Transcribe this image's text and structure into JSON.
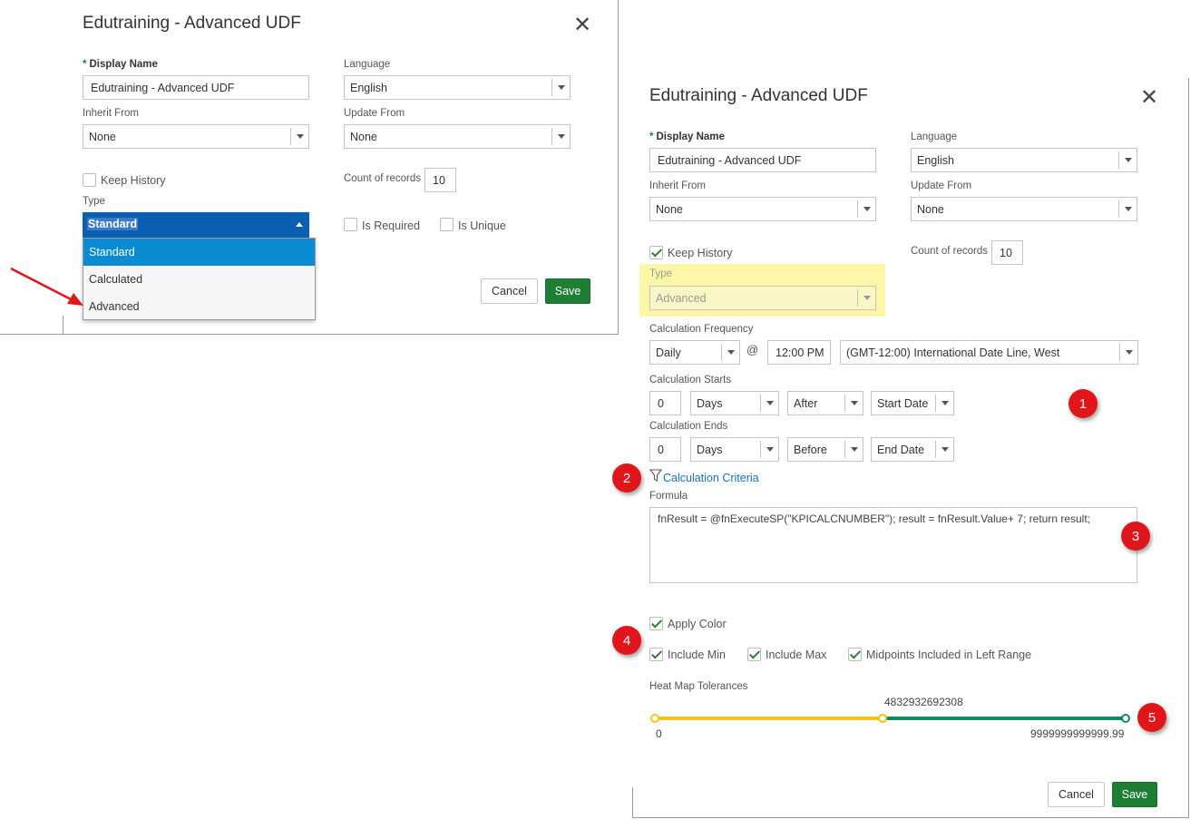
{
  "dialog1": {
    "title": "Edutraining - Advanced UDF",
    "display_name_label": "Display Name",
    "display_name_value": "Edutraining - Advanced UDF",
    "language_label": "Language",
    "language_value": "English",
    "inherit_from_label": "Inherit From",
    "inherit_from_value": "None",
    "update_from_label": "Update From",
    "update_from_value": "None",
    "keep_history_label": "Keep History",
    "count_of_records_label": "Count of records",
    "count_of_records_value": "10",
    "type_label": "Type",
    "type_value": "Standard",
    "type_options": [
      "Standard",
      "Calculated",
      "Advanced"
    ],
    "is_required_label": "Is Required",
    "is_unique_label": "Is Unique",
    "cancel_label": "Cancel",
    "save_label": "Save"
  },
  "dialog2": {
    "title": "Edutraining - Advanced UDF",
    "display_name_label": "Display Name",
    "display_name_value": "Edutraining - Advanced UDF",
    "language_label": "Language",
    "language_value": "English",
    "inherit_from_label": "Inherit From",
    "inherit_from_value": "None",
    "update_from_label": "Update From",
    "update_from_value": "None",
    "keep_history_label": "Keep History",
    "count_of_records_label": "Count of records",
    "count_of_records_value": "10",
    "type_label": "Type",
    "type_value": "Advanced",
    "calc_frequency_label": "Calculation Frequency",
    "frequency_value": "Daily",
    "at_symbol": "@",
    "time_value": "12:00 PM",
    "timezone_value": "(GMT-12:00) International Date Line, West",
    "calc_starts_label": "Calculation Starts",
    "starts_number": "0",
    "starts_unit": "Days",
    "starts_relation": "After",
    "starts_reference": "Start Date",
    "calc_ends_label": "Calculation Ends",
    "ends_number": "0",
    "ends_unit": "Days",
    "ends_relation": "Before",
    "ends_reference": "End Date",
    "calc_criteria_label": "Calculation Criteria",
    "formula_label": "Formula",
    "formula_value": "fnResult = @fnExecuteSP(\"KPICALCNUMBER\"); result = fnResult.Value+ 7; return result;",
    "apply_color_label": "Apply Color",
    "include_min_label": "Include Min",
    "include_max_label": "Include Max",
    "midpoints_label": "Midpoints Included in Left Range",
    "heatmap_label": "Heat Map Tolerances",
    "heatmap_min": "0",
    "heatmap_mid": "4832932692308",
    "heatmap_max": "9999999999999.99",
    "cancel_label": "Cancel",
    "save_label": "Save"
  },
  "badges": [
    "1",
    "2",
    "3",
    "4",
    "5"
  ],
  "colors": {
    "accent_green": "#1e7e34",
    "select_blue": "#0b5fb0",
    "option_highlight": "#0b8bd1",
    "badge_red": "#e0161b",
    "highlight_yellow": "#fbf7a6",
    "range_yellow": "#f0c419",
    "range_green": "#148a5c",
    "link_blue": "#1a6fb8"
  }
}
